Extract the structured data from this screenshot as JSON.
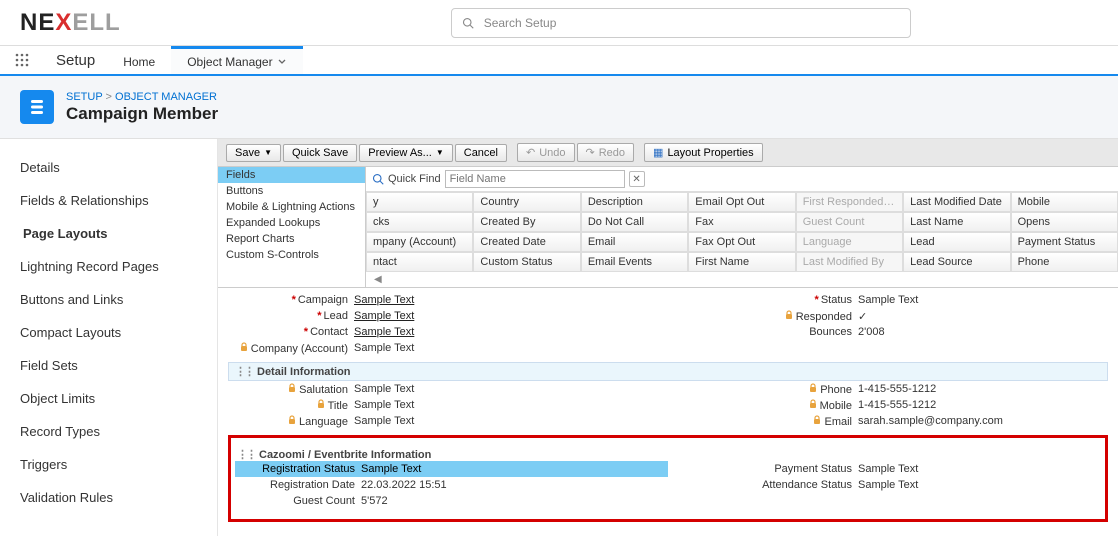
{
  "header": {
    "logo_parts": [
      "NE",
      "X",
      "ELL"
    ],
    "search_placeholder": "Search Setup"
  },
  "nav": {
    "setup": "Setup",
    "tabs": [
      {
        "label": "Home"
      },
      {
        "label": "Object Manager"
      }
    ]
  },
  "breadcrumb": {
    "setup": "SETUP",
    "obj_mgr": "OBJECT MANAGER"
  },
  "page_title": "Campaign Member",
  "sidebar": {
    "items": [
      "Details",
      "Fields & Relationships",
      "Page Layouts",
      "Lightning Record Pages",
      "Buttons and Links",
      "Compact Layouts",
      "Field Sets",
      "Object Limits",
      "Record Types",
      "Triggers",
      "Validation Rules"
    ]
  },
  "toolbar": {
    "save": "Save",
    "quick_save": "Quick Save",
    "preview": "Preview As...",
    "cancel": "Cancel",
    "undo": "Undo",
    "redo": "Redo",
    "layout_props": "Layout Properties"
  },
  "palette": {
    "categories": [
      "Fields",
      "Buttons",
      "Mobile & Lightning Actions",
      "Expanded Lookups",
      "Report Charts",
      "Custom S-Controls"
    ],
    "quick_find": "Quick Find",
    "qf_placeholder": "Field Name",
    "cells": [
      [
        "y",
        "Country",
        "Description",
        "Email Opt Out",
        "First Responded Date",
        "Last Modified Date",
        "Mobile"
      ],
      [
        "cks",
        "Created By",
        "Do Not Call",
        "Fax",
        "Guest Count",
        "Last Name",
        "Opens"
      ],
      [
        "mpany (Account)",
        "Created Date",
        "Email",
        "Fax Opt Out",
        "Language",
        "Lead",
        "Payment Status"
      ],
      [
        "ntact",
        "Custom Status",
        "Email Events",
        "First Name",
        "Last Modified By",
        "Lead Source",
        "Phone"
      ]
    ],
    "dim_cols": [
      4
    ]
  },
  "layout": {
    "top_left": [
      {
        "req": true,
        "label": "Campaign",
        "value": "Sample Text",
        "link": true
      },
      {
        "req": true,
        "label": "Lead",
        "value": "Sample Text",
        "link": true
      },
      {
        "req": true,
        "label": "Contact",
        "value": "Sample Text",
        "link": true
      },
      {
        "lock": true,
        "label": "Company (Account)",
        "value": "Sample Text"
      }
    ],
    "top_right": [
      {
        "req": true,
        "label": "Status",
        "value": "Sample Text"
      },
      {
        "lock": true,
        "label": "Responded",
        "value": "✓"
      },
      {
        "label": "Bounces",
        "value": "2'008"
      }
    ],
    "detail_header": "Detail Information",
    "detail_left": [
      {
        "lock": true,
        "label": "Salutation",
        "value": "Sample Text"
      },
      {
        "lock": true,
        "label": "Title",
        "value": "Sample Text"
      },
      {
        "lock": true,
        "label": "Language",
        "value": "Sample Text"
      }
    ],
    "detail_right": [
      {
        "lock": true,
        "label": "Phone",
        "value": "1-415-555-1212"
      },
      {
        "lock": true,
        "label": "Mobile",
        "value": "1-415-555-1212"
      },
      {
        "lock": true,
        "label": "Email",
        "value": "sarah.sample@company.com"
      }
    ],
    "cazoomi_header": "Cazoomi / Eventbrite Information",
    "cazoomi_left": [
      {
        "label": "Registration Status",
        "value": "Sample Text",
        "highlight": true
      },
      {
        "label": "Registration Date",
        "value": "22.03.2022 15:51"
      },
      {
        "label": "Guest Count",
        "value": "5'572"
      }
    ],
    "cazoomi_right": [
      {
        "label": "Payment Status",
        "value": "Sample Text"
      },
      {
        "label": "Attendance Status",
        "value": "Sample Text"
      }
    ]
  }
}
